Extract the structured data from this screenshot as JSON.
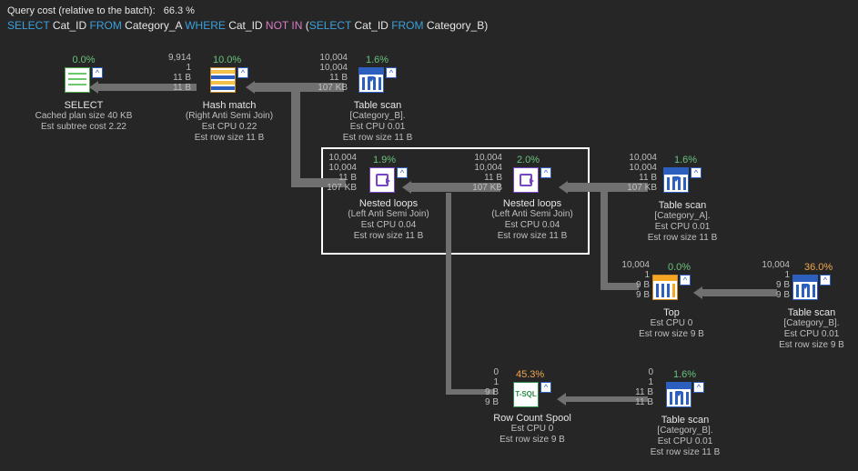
{
  "header": {
    "cost_label": "Query cost (relative to the batch):",
    "cost_value": "66.3 %",
    "sql_tokens": [
      {
        "t": "kw",
        "v": "SELECT "
      },
      {
        "t": "id",
        "v": "Cat_ID "
      },
      {
        "t": "kw",
        "v": "FROM "
      },
      {
        "t": "id",
        "v": "Category_A "
      },
      {
        "t": "kw",
        "v": "WHERE "
      },
      {
        "t": "id",
        "v": "Cat_ID "
      },
      {
        "t": "fn",
        "v": "NOT IN "
      },
      {
        "t": "id",
        "v": "("
      },
      {
        "t": "kw",
        "v": "SELECT "
      },
      {
        "t": "id",
        "v": "Cat_ID "
      },
      {
        "t": "kw",
        "v": "FROM "
      },
      {
        "t": "id",
        "v": "Category_B)"
      }
    ]
  },
  "nodes": {
    "select": {
      "pct": "0.0%",
      "pct_cls": "pct-green",
      "title": "SELECT",
      "lines": [
        "Cached plan size 40 KB",
        "Est subtree cost 2.22"
      ]
    },
    "hash": {
      "pct": "10.0%",
      "pct_cls": "pct-green",
      "stats": [
        "9,914",
        "1",
        "11 B",
        "11 B"
      ],
      "title": "Hash match",
      "sub": "(Right Anti Semi Join)",
      "lines": [
        "Est CPU 0.22",
        "Est row size 11 B"
      ]
    },
    "scan_b1": {
      "pct": "1.6%",
      "pct_cls": "pct-green",
      "stats": [
        "10,004",
        "10,004",
        "11 B",
        "107 KB"
      ],
      "title": "Table scan",
      "sub": "[Category_B].",
      "lines": [
        "Est CPU 0.01",
        "Est row size 11 B"
      ]
    },
    "loop1": {
      "pct": "1.9%",
      "pct_cls": "pct-green",
      "stats": [
        "10,004",
        "10,004",
        "11 B",
        "107 KB"
      ],
      "title": "Nested loops",
      "sub": "(Left Anti Semi Join)",
      "lines": [
        "Est CPU 0.04",
        "Est row size 11 B"
      ]
    },
    "loop2": {
      "pct": "2.0%",
      "pct_cls": "pct-green",
      "stats": [
        "10,004",
        "10,004",
        "11 B",
        "107 KB"
      ],
      "title": "Nested loops",
      "sub": "(Left Anti Semi Join)",
      "lines": [
        "Est CPU 0.04",
        "Est row size 11 B"
      ]
    },
    "scan_a": {
      "pct": "1.6%",
      "pct_cls": "pct-green",
      "stats": [
        "10,004",
        "10,004",
        "11 B",
        "107 KB"
      ],
      "title": "Table scan",
      "sub": "[Category_A].",
      "lines": [
        "Est CPU 0.01",
        "Est row size 11 B"
      ]
    },
    "top": {
      "pct": "0.0%",
      "pct_cls": "pct-green",
      "stats": [
        "10,004",
        "1",
        "9 B",
        "9 B"
      ],
      "title": "Top",
      "sub": "",
      "lines": [
        "Est CPU 0",
        "Est row size 9 B"
      ]
    },
    "scan_b2": {
      "pct": "36.0%",
      "pct_cls": "pct-orange",
      "stats": [
        "10,004",
        "1",
        "9 B",
        "9 B"
      ],
      "title": "Table scan",
      "sub": "[Category_B].",
      "lines": [
        "Est CPU 0.01",
        "Est row size 9 B"
      ]
    },
    "spool": {
      "pct": "45.3%",
      "pct_cls": "pct-orange",
      "stats": [
        "0",
        "1",
        "9 B",
        "9 B"
      ],
      "title": "Row Count Spool",
      "sub": "",
      "lines": [
        "Est CPU 0",
        "Est row size 9 B"
      ]
    },
    "scan_b3": {
      "pct": "1.6%",
      "pct_cls": "pct-green",
      "stats": [
        "0",
        "1",
        "11 B",
        "11 B"
      ],
      "title": "Table scan",
      "sub": "[Category_B].",
      "lines": [
        "Est CPU 0.01",
        "Est row size 11 B"
      ]
    }
  },
  "icons": {
    "tsql_label": "T-SQL",
    "badge_glyph": "^"
  }
}
